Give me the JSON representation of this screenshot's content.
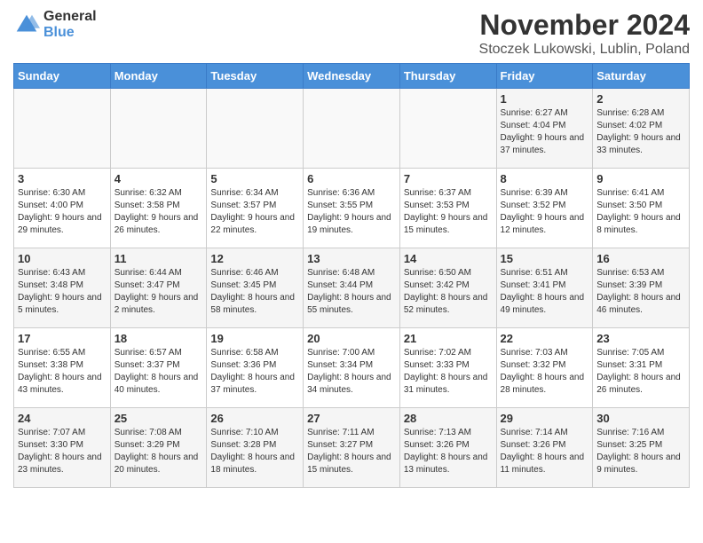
{
  "logo": {
    "general": "General",
    "blue": "Blue"
  },
  "title": "November 2024",
  "location": "Stoczek Lukowski, Lublin, Poland",
  "days_of_week": [
    "Sunday",
    "Monday",
    "Tuesday",
    "Wednesday",
    "Thursday",
    "Friday",
    "Saturday"
  ],
  "weeks": [
    [
      {
        "day": "",
        "info": ""
      },
      {
        "day": "",
        "info": ""
      },
      {
        "day": "",
        "info": ""
      },
      {
        "day": "",
        "info": ""
      },
      {
        "day": "",
        "info": ""
      },
      {
        "day": "1",
        "info": "Sunrise: 6:27 AM\nSunset: 4:04 PM\nDaylight: 9 hours and 37 minutes."
      },
      {
        "day": "2",
        "info": "Sunrise: 6:28 AM\nSunset: 4:02 PM\nDaylight: 9 hours and 33 minutes."
      }
    ],
    [
      {
        "day": "3",
        "info": "Sunrise: 6:30 AM\nSunset: 4:00 PM\nDaylight: 9 hours and 29 minutes."
      },
      {
        "day": "4",
        "info": "Sunrise: 6:32 AM\nSunset: 3:58 PM\nDaylight: 9 hours and 26 minutes."
      },
      {
        "day": "5",
        "info": "Sunrise: 6:34 AM\nSunset: 3:57 PM\nDaylight: 9 hours and 22 minutes."
      },
      {
        "day": "6",
        "info": "Sunrise: 6:36 AM\nSunset: 3:55 PM\nDaylight: 9 hours and 19 minutes."
      },
      {
        "day": "7",
        "info": "Sunrise: 6:37 AM\nSunset: 3:53 PM\nDaylight: 9 hours and 15 minutes."
      },
      {
        "day": "8",
        "info": "Sunrise: 6:39 AM\nSunset: 3:52 PM\nDaylight: 9 hours and 12 minutes."
      },
      {
        "day": "9",
        "info": "Sunrise: 6:41 AM\nSunset: 3:50 PM\nDaylight: 9 hours and 8 minutes."
      }
    ],
    [
      {
        "day": "10",
        "info": "Sunrise: 6:43 AM\nSunset: 3:48 PM\nDaylight: 9 hours and 5 minutes."
      },
      {
        "day": "11",
        "info": "Sunrise: 6:44 AM\nSunset: 3:47 PM\nDaylight: 9 hours and 2 minutes."
      },
      {
        "day": "12",
        "info": "Sunrise: 6:46 AM\nSunset: 3:45 PM\nDaylight: 8 hours and 58 minutes."
      },
      {
        "day": "13",
        "info": "Sunrise: 6:48 AM\nSunset: 3:44 PM\nDaylight: 8 hours and 55 minutes."
      },
      {
        "day": "14",
        "info": "Sunrise: 6:50 AM\nSunset: 3:42 PM\nDaylight: 8 hours and 52 minutes."
      },
      {
        "day": "15",
        "info": "Sunrise: 6:51 AM\nSunset: 3:41 PM\nDaylight: 8 hours and 49 minutes."
      },
      {
        "day": "16",
        "info": "Sunrise: 6:53 AM\nSunset: 3:39 PM\nDaylight: 8 hours and 46 minutes."
      }
    ],
    [
      {
        "day": "17",
        "info": "Sunrise: 6:55 AM\nSunset: 3:38 PM\nDaylight: 8 hours and 43 minutes."
      },
      {
        "day": "18",
        "info": "Sunrise: 6:57 AM\nSunset: 3:37 PM\nDaylight: 8 hours and 40 minutes."
      },
      {
        "day": "19",
        "info": "Sunrise: 6:58 AM\nSunset: 3:36 PM\nDaylight: 8 hours and 37 minutes."
      },
      {
        "day": "20",
        "info": "Sunrise: 7:00 AM\nSunset: 3:34 PM\nDaylight: 8 hours and 34 minutes."
      },
      {
        "day": "21",
        "info": "Sunrise: 7:02 AM\nSunset: 3:33 PM\nDaylight: 8 hours and 31 minutes."
      },
      {
        "day": "22",
        "info": "Sunrise: 7:03 AM\nSunset: 3:32 PM\nDaylight: 8 hours and 28 minutes."
      },
      {
        "day": "23",
        "info": "Sunrise: 7:05 AM\nSunset: 3:31 PM\nDaylight: 8 hours and 26 minutes."
      }
    ],
    [
      {
        "day": "24",
        "info": "Sunrise: 7:07 AM\nSunset: 3:30 PM\nDaylight: 8 hours and 23 minutes."
      },
      {
        "day": "25",
        "info": "Sunrise: 7:08 AM\nSunset: 3:29 PM\nDaylight: 8 hours and 20 minutes."
      },
      {
        "day": "26",
        "info": "Sunrise: 7:10 AM\nSunset: 3:28 PM\nDaylight: 8 hours and 18 minutes."
      },
      {
        "day": "27",
        "info": "Sunrise: 7:11 AM\nSunset: 3:27 PM\nDaylight: 8 hours and 15 minutes."
      },
      {
        "day": "28",
        "info": "Sunrise: 7:13 AM\nSunset: 3:26 PM\nDaylight: 8 hours and 13 minutes."
      },
      {
        "day": "29",
        "info": "Sunrise: 7:14 AM\nSunset: 3:26 PM\nDaylight: 8 hours and 11 minutes."
      },
      {
        "day": "30",
        "info": "Sunrise: 7:16 AM\nSunset: 3:25 PM\nDaylight: 8 hours and 9 minutes."
      }
    ]
  ]
}
